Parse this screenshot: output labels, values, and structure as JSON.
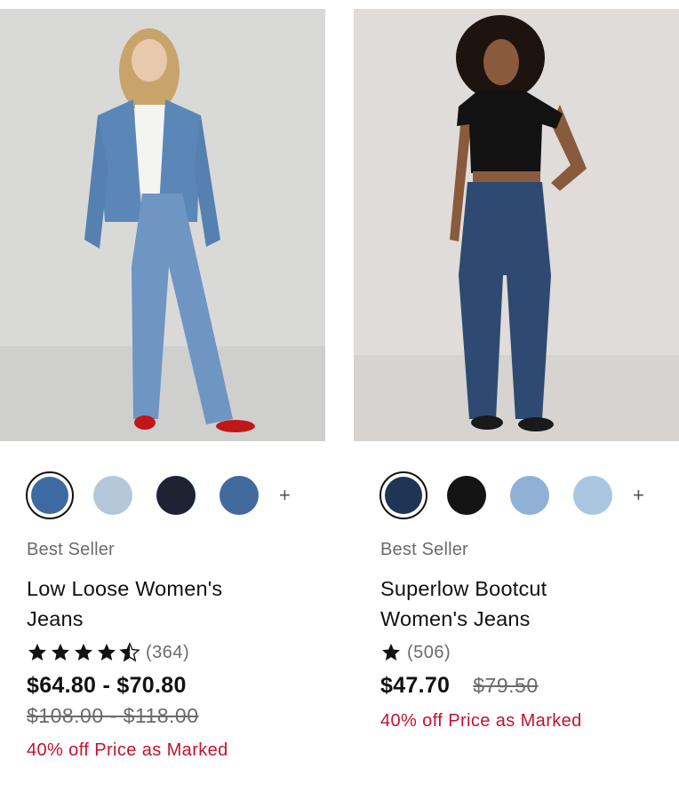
{
  "products": [
    {
      "badge": "Best Seller",
      "title_line1": "Low Loose Women's",
      "title_line2": "Jeans",
      "rating": 4.5,
      "review_count": "(364)",
      "price": "$64.80 - $70.80",
      "original_price": "$108.00 - $118.00",
      "promo": "40% off Price as Marked",
      "swatches": [
        "#3e6aa3",
        "#b4c8da",
        "#1c2333",
        "#426a9c"
      ],
      "more_label": "+"
    },
    {
      "badge": "Best Seller",
      "title_line1": "Superlow Bootcut",
      "title_line2": "Women's Jeans",
      "rating": 1,
      "review_count": "(506)",
      "price": "$47.70",
      "original_price": "$79.50",
      "promo": "40% off Price as Marked",
      "swatches": [
        "#1f3556",
        "#141414",
        "#8fb1d6",
        "#a9c6e0"
      ],
      "more_label": "+"
    }
  ],
  "colors": {
    "promo": "#c4122f",
    "muted": "#6b6b6b",
    "text": "#111111"
  }
}
